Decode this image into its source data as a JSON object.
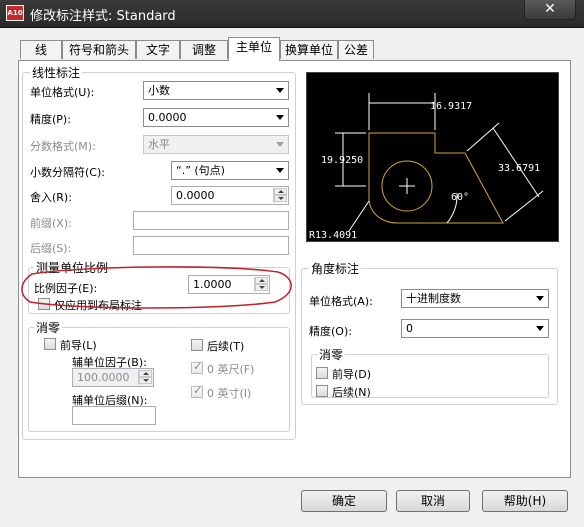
{
  "window": {
    "title": "修改标注样式: Standard",
    "close": "✕"
  },
  "tabs": [
    "线",
    "符号和箭头",
    "文字",
    "调整",
    "主单位",
    "换算单位",
    "公差"
  ],
  "linear": {
    "group_title": "线性标注",
    "unit_format_label": "单位格式(U):",
    "unit_format_value": "小数",
    "precision_label": "精度(P):",
    "precision_value": "0.0000",
    "fraction_label": "分数格式(M):",
    "fraction_value": "水平",
    "decimal_sep_label": "小数分隔符(C):",
    "decimal_sep_value": "“.”  (句点)",
    "round_label": "舍入(R):",
    "round_value": "0.0000",
    "prefix_label": "前缀(X):",
    "prefix_value": "",
    "suffix_label": "后缀(S):",
    "suffix_value": ""
  },
  "scale": {
    "group_title": "测量单位比例",
    "factor_label": "比例因子(E):",
    "factor_value": "1.0000",
    "layout_only_label": "仅应用到布局标注"
  },
  "zero_linear": {
    "group_title": "消零",
    "leading_label": "前导(L)",
    "trailing_label": "后续(T)",
    "sub_factor_label": "辅单位因子(B):",
    "sub_factor_value": "100.0000",
    "sub_suffix_label": "辅单位后缀(N):",
    "sub_suffix_value": "",
    "feet_label": "0 英尺(F)",
    "inches_label": "0 英寸(I)"
  },
  "angular": {
    "group_title": "角度标注",
    "unit_format_label": "单位格式(A):",
    "unit_format_value": "十进制度数",
    "precision_label": "精度(O):",
    "precision_value": "0",
    "zero_title": "消零",
    "leading_label": "前导(D)",
    "trailing_label": "后续(N)"
  },
  "preview": {
    "dim_top": "16.9317",
    "dim_left": "19.9250",
    "dim_right": "33.6791",
    "dim_angle": "60°",
    "dim_radius": "R13.4091",
    "colors": {
      "bg": "#000000",
      "dim": "#ffffff",
      "geometry": "#d7a53a"
    }
  },
  "buttons": {
    "ok": "确定",
    "cancel": "取消",
    "help": "帮助(H)"
  }
}
